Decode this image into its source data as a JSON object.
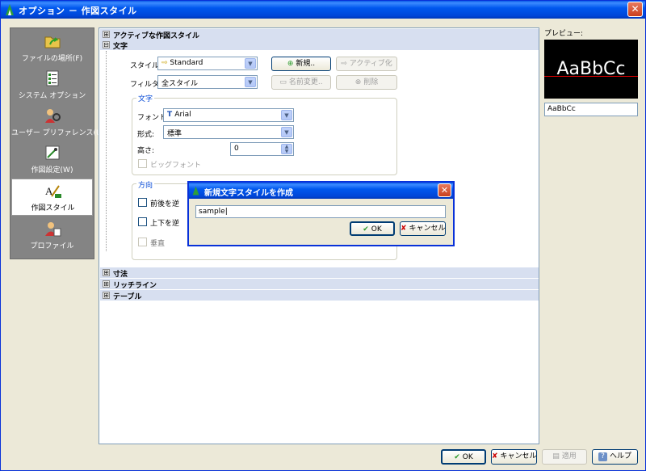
{
  "window": {
    "title": "オプション － 作図スタイル",
    "close": "✕"
  },
  "sidebar": {
    "items": [
      {
        "label": "ファイルの場所(F)",
        "icon": "folder-arrow-icon",
        "active": false
      },
      {
        "label": "システム オプション",
        "icon": "system-options-icon",
        "active": false
      },
      {
        "label": "ユーザー プリファレンス(U)",
        "icon": "user-preferences-icon",
        "active": false
      },
      {
        "label": "作図設定(W)",
        "icon": "drafting-settings-icon",
        "active": false
      },
      {
        "label": "作図スタイル",
        "icon": "drawing-style-icon",
        "active": true
      },
      {
        "label": "プロファイル",
        "icon": "profile-icon",
        "active": false
      }
    ]
  },
  "tree": {
    "section_active_style": "アクティブな作図スタイル",
    "section_text": "文字",
    "section_dimension": "寸法",
    "section_leader": "リッチライン",
    "section_table": "テーブル",
    "plus": "⊞",
    "minus": "⊟"
  },
  "text_settings": {
    "style_label": "スタイル:",
    "style_value": "Standard",
    "filter_label": "フィルタ:",
    "filter_value": "全スタイル",
    "new_button": "新規..",
    "activate_button": "アクティブ化",
    "rename_button": "名前変更..",
    "delete_button": "削除",
    "font_group_title": "文字",
    "font_label": "フォント:",
    "font_value": "Arial",
    "form_label": "形式:",
    "form_value": "標準",
    "height_label": "高さ:",
    "height_value": "0",
    "bigfont_label": "ビッグフォント",
    "direction_group_title": "方向",
    "backwards_label": "前後を逆",
    "upside_down_label": "上下を逆",
    "vertical_label": "垂直"
  },
  "dialog": {
    "title": "新規文字スタイルを作成",
    "input_value": "sample",
    "ok": "OK",
    "cancel": "キャンセル"
  },
  "preview": {
    "label": "プレビュー:",
    "sample_text": "AaBbCc",
    "input_value": "AaBbCc"
  },
  "footer": {
    "ok": "OK",
    "cancel": "キャンセル",
    "apply": "適用",
    "help": "ヘルプ"
  },
  "colors": {
    "titlebar": "#0054e3",
    "sidebar_bg": "#848484",
    "section_header": "#d7dff0",
    "preview_bg": "#000000",
    "preview_line": "#dd0000"
  }
}
